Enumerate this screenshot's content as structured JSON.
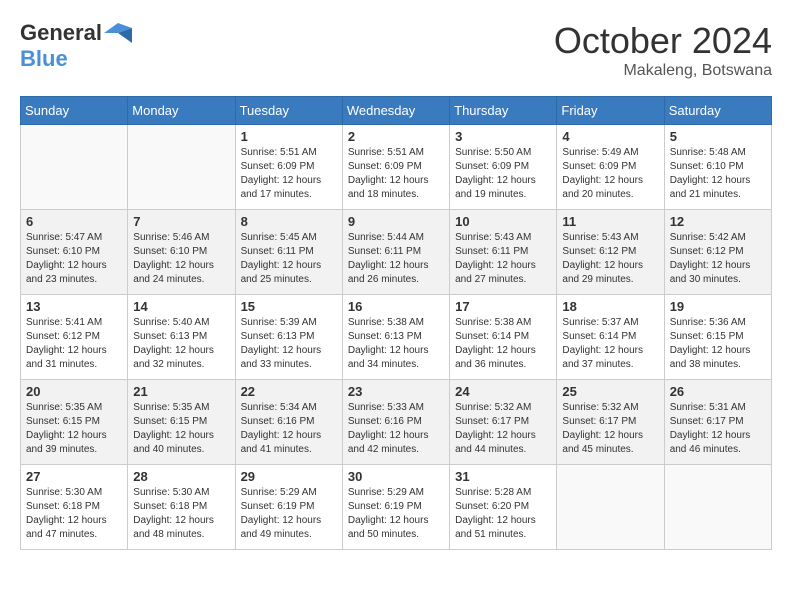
{
  "header": {
    "logo_general": "General",
    "logo_blue": "Blue",
    "month_title": "October 2024",
    "location": "Makaleng, Botswana"
  },
  "weekdays": [
    "Sunday",
    "Monday",
    "Tuesday",
    "Wednesday",
    "Thursday",
    "Friday",
    "Saturday"
  ],
  "weeks": [
    [
      {
        "day": "",
        "info": ""
      },
      {
        "day": "",
        "info": ""
      },
      {
        "day": "1",
        "info": "Sunrise: 5:51 AM\nSunset: 6:09 PM\nDaylight: 12 hours and 17 minutes."
      },
      {
        "day": "2",
        "info": "Sunrise: 5:51 AM\nSunset: 6:09 PM\nDaylight: 12 hours and 18 minutes."
      },
      {
        "day": "3",
        "info": "Sunrise: 5:50 AM\nSunset: 6:09 PM\nDaylight: 12 hours and 19 minutes."
      },
      {
        "day": "4",
        "info": "Sunrise: 5:49 AM\nSunset: 6:09 PM\nDaylight: 12 hours and 20 minutes."
      },
      {
        "day": "5",
        "info": "Sunrise: 5:48 AM\nSunset: 6:10 PM\nDaylight: 12 hours and 21 minutes."
      }
    ],
    [
      {
        "day": "6",
        "info": "Sunrise: 5:47 AM\nSunset: 6:10 PM\nDaylight: 12 hours and 23 minutes."
      },
      {
        "day": "7",
        "info": "Sunrise: 5:46 AM\nSunset: 6:10 PM\nDaylight: 12 hours and 24 minutes."
      },
      {
        "day": "8",
        "info": "Sunrise: 5:45 AM\nSunset: 6:11 PM\nDaylight: 12 hours and 25 minutes."
      },
      {
        "day": "9",
        "info": "Sunrise: 5:44 AM\nSunset: 6:11 PM\nDaylight: 12 hours and 26 minutes."
      },
      {
        "day": "10",
        "info": "Sunrise: 5:43 AM\nSunset: 6:11 PM\nDaylight: 12 hours and 27 minutes."
      },
      {
        "day": "11",
        "info": "Sunrise: 5:43 AM\nSunset: 6:12 PM\nDaylight: 12 hours and 29 minutes."
      },
      {
        "day": "12",
        "info": "Sunrise: 5:42 AM\nSunset: 6:12 PM\nDaylight: 12 hours and 30 minutes."
      }
    ],
    [
      {
        "day": "13",
        "info": "Sunrise: 5:41 AM\nSunset: 6:12 PM\nDaylight: 12 hours and 31 minutes."
      },
      {
        "day": "14",
        "info": "Sunrise: 5:40 AM\nSunset: 6:13 PM\nDaylight: 12 hours and 32 minutes."
      },
      {
        "day": "15",
        "info": "Sunrise: 5:39 AM\nSunset: 6:13 PM\nDaylight: 12 hours and 33 minutes."
      },
      {
        "day": "16",
        "info": "Sunrise: 5:38 AM\nSunset: 6:13 PM\nDaylight: 12 hours and 34 minutes."
      },
      {
        "day": "17",
        "info": "Sunrise: 5:38 AM\nSunset: 6:14 PM\nDaylight: 12 hours and 36 minutes."
      },
      {
        "day": "18",
        "info": "Sunrise: 5:37 AM\nSunset: 6:14 PM\nDaylight: 12 hours and 37 minutes."
      },
      {
        "day": "19",
        "info": "Sunrise: 5:36 AM\nSunset: 6:15 PM\nDaylight: 12 hours and 38 minutes."
      }
    ],
    [
      {
        "day": "20",
        "info": "Sunrise: 5:35 AM\nSunset: 6:15 PM\nDaylight: 12 hours and 39 minutes."
      },
      {
        "day": "21",
        "info": "Sunrise: 5:35 AM\nSunset: 6:15 PM\nDaylight: 12 hours and 40 minutes."
      },
      {
        "day": "22",
        "info": "Sunrise: 5:34 AM\nSunset: 6:16 PM\nDaylight: 12 hours and 41 minutes."
      },
      {
        "day": "23",
        "info": "Sunrise: 5:33 AM\nSunset: 6:16 PM\nDaylight: 12 hours and 42 minutes."
      },
      {
        "day": "24",
        "info": "Sunrise: 5:32 AM\nSunset: 6:17 PM\nDaylight: 12 hours and 44 minutes."
      },
      {
        "day": "25",
        "info": "Sunrise: 5:32 AM\nSunset: 6:17 PM\nDaylight: 12 hours and 45 minutes."
      },
      {
        "day": "26",
        "info": "Sunrise: 5:31 AM\nSunset: 6:17 PM\nDaylight: 12 hours and 46 minutes."
      }
    ],
    [
      {
        "day": "27",
        "info": "Sunrise: 5:30 AM\nSunset: 6:18 PM\nDaylight: 12 hours and 47 minutes."
      },
      {
        "day": "28",
        "info": "Sunrise: 5:30 AM\nSunset: 6:18 PM\nDaylight: 12 hours and 48 minutes."
      },
      {
        "day": "29",
        "info": "Sunrise: 5:29 AM\nSunset: 6:19 PM\nDaylight: 12 hours and 49 minutes."
      },
      {
        "day": "30",
        "info": "Sunrise: 5:29 AM\nSunset: 6:19 PM\nDaylight: 12 hours and 50 minutes."
      },
      {
        "day": "31",
        "info": "Sunrise: 5:28 AM\nSunset: 6:20 PM\nDaylight: 12 hours and 51 minutes."
      },
      {
        "day": "",
        "info": ""
      },
      {
        "day": "",
        "info": ""
      }
    ]
  ]
}
